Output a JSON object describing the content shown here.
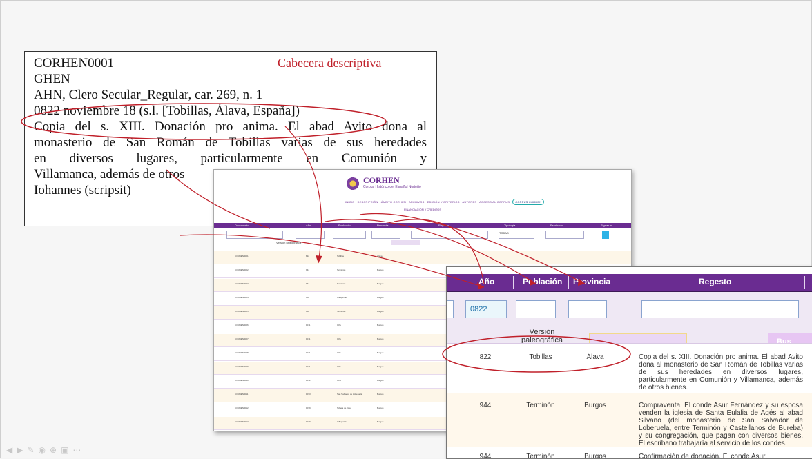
{
  "descriptive_header": {
    "id": "CORHEN0001",
    "code": "GHEN",
    "annotation": "Cabecera descriptiva",
    "archive_ref": "AHN, Clero Secular_Regular, car. 269, n. 1",
    "date_place": "0822 noviembre 18 (s.l. [Tobillas, Álava, España])",
    "summary_lines": [
      "Copia del s. XIII. Donación pro anima. El abad Avito dona al",
      "monasterio de San Román de Tobillas varias de sus heredades",
      "en diversos lugares, particularmente en Comunión y",
      "Villamanca, además de otros",
      "Iohannes (scripsit)"
    ]
  },
  "app": {
    "logo_title": "CORHEN",
    "logo_subtitle": "Corpus Histórico del Español Norteño",
    "nav": "INICIO · DESCRIPCIÓN · ÁMBITO CORHEN · ARCHIVOS · EDICIÓN Y CRITERIOS · AUTORES · ACCESO AL CORPUS ·",
    "nav_button": "CORPUS CORHEN",
    "nav2": "FINANCIACIÓN Y CRÉDITOS",
    "columns": [
      "Documento",
      "Año",
      "Población",
      "Provincia",
      "Regesto",
      "Tipología",
      "Escribano",
      "Signatura"
    ],
    "select_value": "TODAS",
    "paleographic": "Versión paleográfica",
    "rows": [
      {
        "doc": "CORHEN0001",
        "year": "822",
        "town": "Tobillas",
        "prov": "Álava"
      },
      {
        "doc": "CORHEN0002",
        "year": "944",
        "town": "Terminón",
        "prov": "Burgos"
      },
      {
        "doc": "CORHEN0003",
        "year": "944",
        "town": "Terminón",
        "prov": "Burgos"
      },
      {
        "doc": "CORHEN0004",
        "year": "950",
        "town": "Cillaperlata",
        "prov": "Burgos"
      },
      {
        "doc": "CORHEN0005",
        "year": "960",
        "town": "Terminón",
        "prov": "Burgos"
      },
      {
        "doc": "CORHEN0006",
        "year": "1011",
        "town": "Oña",
        "prov": "Burgos"
      },
      {
        "doc": "CORHEN0007",
        "year": "1011",
        "town": "Oña",
        "prov": "Burgos"
      },
      {
        "doc": "CORHEN0008",
        "year": "1011",
        "town": "Oña",
        "prov": "Burgos"
      },
      {
        "doc": "CORHEN0009",
        "year": "1011",
        "town": "Oña",
        "prov": "Burgos"
      },
      {
        "doc": "CORHEN0010",
        "year": "1012",
        "town": "Oña",
        "prov": "Burgos"
      },
      {
        "doc": "CORHEN0011",
        "year": "1033",
        "town": "San Salvador de Loberuela",
        "prov": "Burgos"
      },
      {
        "doc": "CORHEN0012",
        "year": "1039",
        "town": "Tobera de Oca",
        "prov": "Burgos"
      },
      {
        "doc": "CORHEN0013",
        "year": "1049",
        "town": "Cillaperlata",
        "prov": "Burgos"
      }
    ]
  },
  "zoom": {
    "headers": [
      "Año",
      "Población",
      "Provincia",
      "Regesto"
    ],
    "year_filter": "0822",
    "paleographic_label": "Versión paleográfica",
    "search_button": "Bus",
    "rows": [
      {
        "year": "822",
        "town": "Tobillas",
        "prov": "Álava",
        "regesto": "Copia del s. XIII. Donación pro anima. El abad Avito dona al monasterio de San Román de Tobillas varias de sus heredades en diversos lugares, particularmente en Comunión y Villamanca, además de otros bienes."
      },
      {
        "year": "944",
        "town": "Terminón",
        "prov": "Burgos",
        "regesto": "Compraventa. El conde Asur Fernández y su esposa venden la iglesia de Santa Eulalia de Agés al abad Silvano (del monasterio de San Salvador de Loberuela, entre Terminón y Castellanos de Bureba) y su congregación, que pagan con diversos bienes. El escribano trabajaría al servicio de los condes."
      },
      {
        "year": "944",
        "town": "Terminón",
        "prov": "Burgos",
        "regesto": "Confirmación de donación. El conde Asur"
      }
    ]
  },
  "colors": {
    "accent": "#6a2c91",
    "annotation_red": "#c0202a"
  },
  "toolbar_icons": [
    "prev-icon",
    "next-icon",
    "pen-icon",
    "eye-icon",
    "zoom-icon",
    "slides-icon",
    "more-icon"
  ]
}
